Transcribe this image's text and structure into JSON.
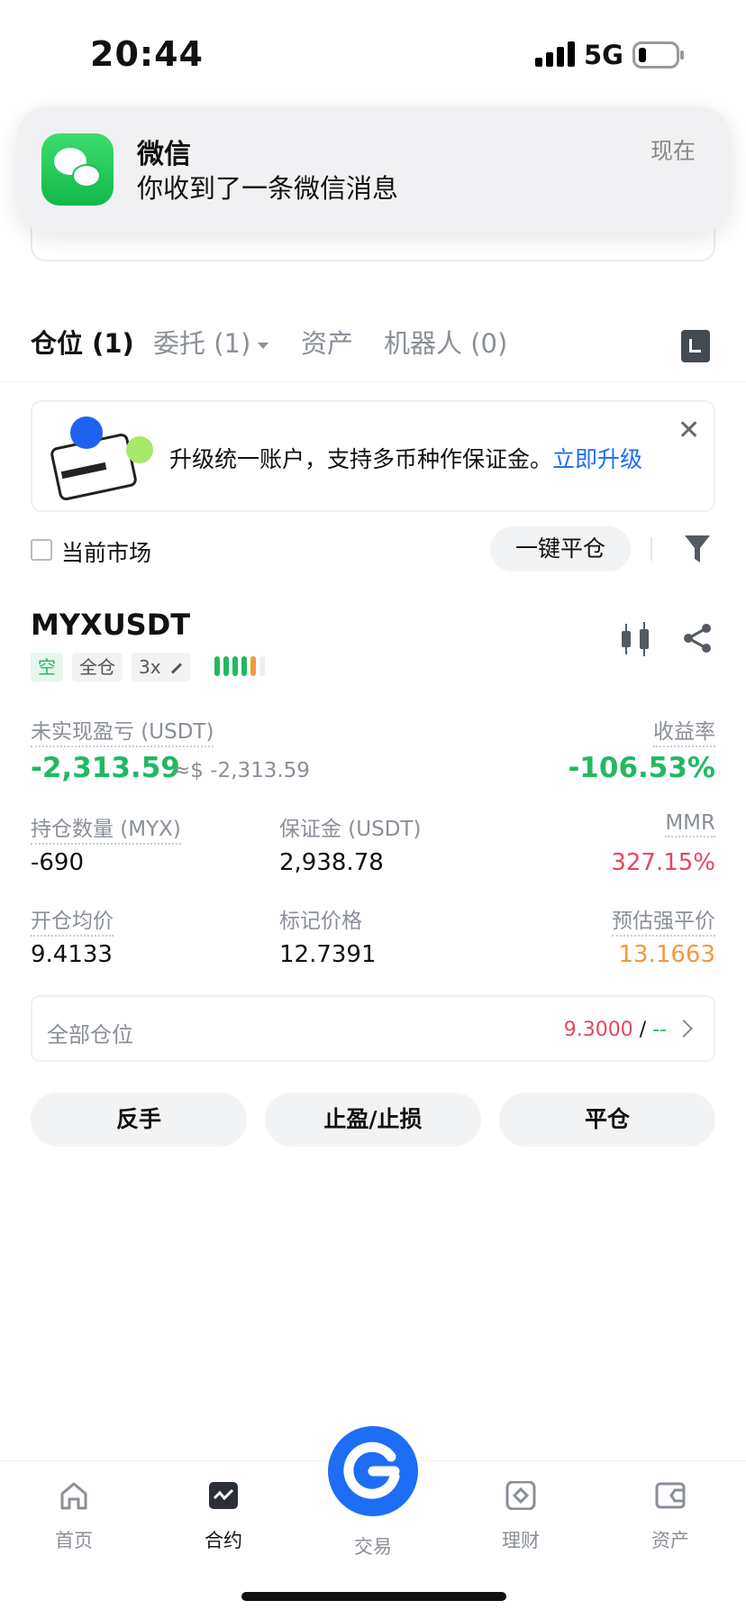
{
  "status_bar": {
    "time": "20:44",
    "network": "5G"
  },
  "notification": {
    "app": "微信",
    "message": "你收到了一条微信消息",
    "time": "现在"
  },
  "tabs": [
    {
      "label": "仓位 (1)",
      "active": true
    },
    {
      "label": "委托 (1)",
      "active": false
    },
    {
      "label": "资产",
      "active": false
    },
    {
      "label": "机器人 (0)",
      "active": false
    }
  ],
  "promo": {
    "text": "升级统一账户，支持多币种作保证金。",
    "link": "立即升级"
  },
  "filter": {
    "current_market": "当前市场",
    "close_all": "一键平仓"
  },
  "position": {
    "symbol": "MYXUSDT",
    "side": "空",
    "margin_mode": "全仓",
    "leverage": "3x",
    "unrealized_pnl_label": "未实现盈亏 (USDT)",
    "unrealized_pnl": "-2,313.59",
    "unrealized_pnl_usd": "≈$ -2,313.59",
    "roe_label": "收益率",
    "roe": "-106.53%",
    "size_label": "持仓数量 (MYX)",
    "size": "-690",
    "margin_label": "保证金 (USDT)",
    "margin": "2,938.78",
    "mmr_label": "MMR",
    "mmr": "327.15%",
    "entry_label": "开仓均价",
    "entry": "9.4133",
    "mark_label": "标记价格",
    "mark": "12.7391",
    "liq_label": "预估强平价",
    "liq": "13.1663"
  },
  "all_positions": {
    "label": "全部仓位",
    "value": "9.3000",
    "separator": "/",
    "dash": "--"
  },
  "actions": {
    "reverse": "反手",
    "tp_sl": "止盈/止损",
    "close": "平仓"
  },
  "bottom_nav": [
    {
      "label": "首页",
      "icon": "home-icon"
    },
    {
      "label": "合约",
      "icon": "futures-icon"
    },
    {
      "label": "交易",
      "icon": "trade-icon"
    },
    {
      "label": "理财",
      "icon": "earn-icon"
    },
    {
      "label": "资产",
      "icon": "wallet-icon"
    }
  ],
  "colors": {
    "green": "#22b863",
    "red": "#e8455f",
    "orange": "#f09a3c",
    "blue": "#1e6df5"
  }
}
